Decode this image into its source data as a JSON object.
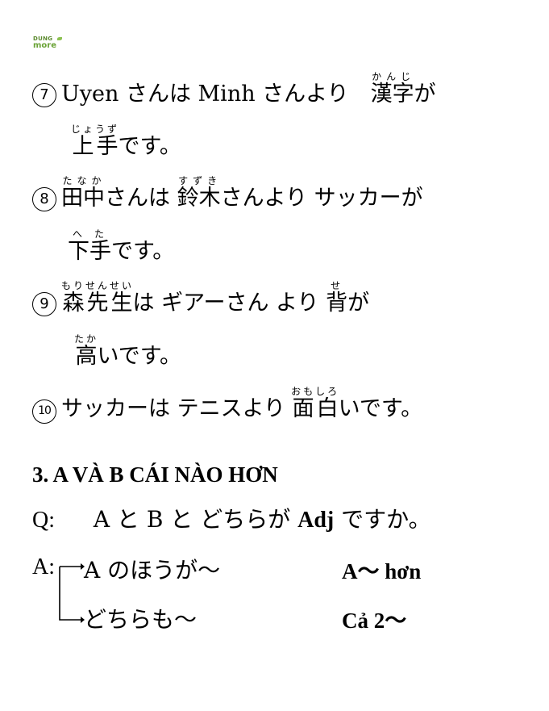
{
  "logo": {
    "line1": "DUNG",
    "line2": "more"
  },
  "sentences": [
    {
      "num": "7",
      "line1": [
        {
          "t": "Uyen さんは Minh さんより　"
        },
        {
          "t": "漢字",
          "r": "かんじ"
        },
        {
          "t": "が"
        }
      ],
      "line2": [
        {
          "t": "上手",
          "r": "じょうず"
        },
        {
          "t": "です。"
        }
      ]
    },
    {
      "num": "8",
      "line1": [
        {
          "t": "田中",
          "r": "たなか"
        },
        {
          "t": "さんは "
        },
        {
          "t": "鈴木",
          "r": "すずき"
        },
        {
          "t": "さんより サッカーが"
        }
      ],
      "line2": [
        {
          "t": "下手",
          "r": "へた"
        },
        {
          "t": "です。"
        }
      ]
    },
    {
      "num": "9",
      "line1": [
        {
          "t": "森先生",
          "r": "もりせんせい"
        },
        {
          "t": "は ギアーさん より "
        },
        {
          "t": "背",
          "r": "せ"
        },
        {
          "t": "が"
        }
      ],
      "line2": [
        {
          "t": "高",
          "r": "たか"
        },
        {
          "t": "いです。"
        }
      ]
    },
    {
      "num": "10",
      "line1": [
        {
          "t": "サッカーは テニスより "
        },
        {
          "t": "面白",
          "r": "おもしろ"
        },
        {
          "t": "いです。"
        }
      ]
    }
  ],
  "section": {
    "title": "3. A VÀ B CÁI NÀO HƠN",
    "q_label": "Q:",
    "q_text_pre": "A と B と どちらが ",
    "q_adj": "Adj",
    "q_text_post": " ですか。",
    "a_label": "A:",
    "answers": [
      {
        "jp": "A のほうが～",
        "vi": "A～ hơn"
      },
      {
        "jp": "どちらも～",
        "vi": "Cả 2～"
      }
    ]
  }
}
